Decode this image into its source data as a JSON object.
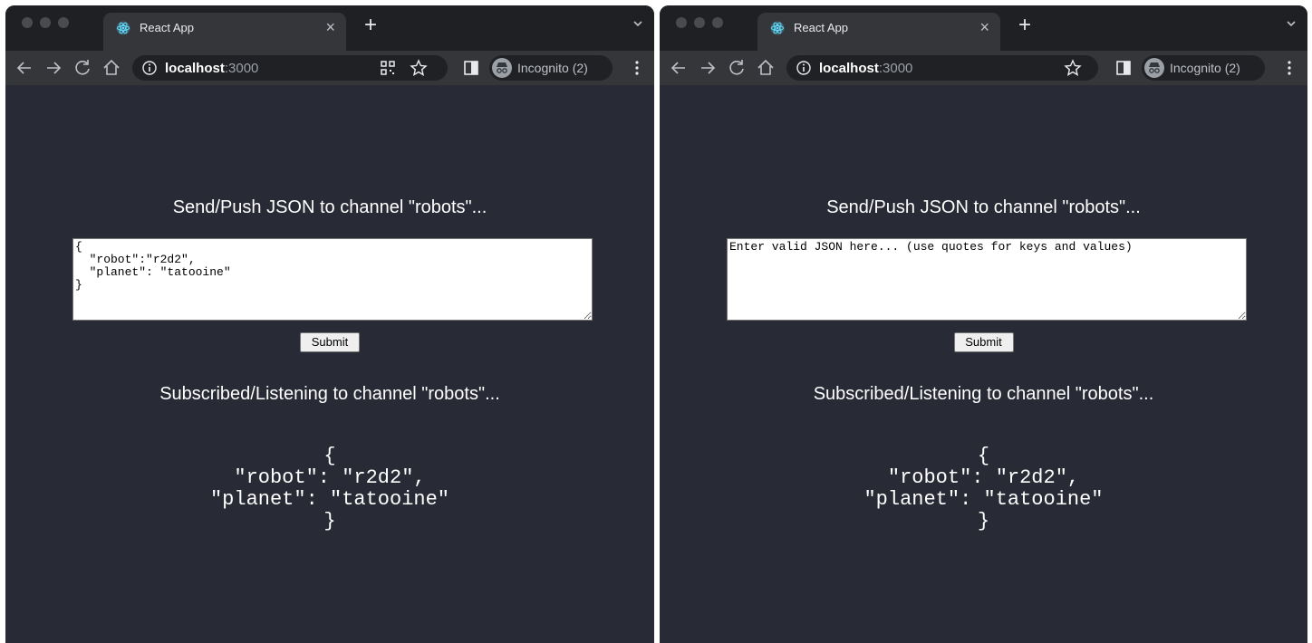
{
  "windows": [
    {
      "tab": {
        "title": "React App",
        "close": "×"
      },
      "new_tab": "+",
      "address": {
        "host": "localhost",
        "port": ":3000"
      },
      "incognito_label": "Incognito (2)",
      "content": {
        "send_heading": "Send/Push JSON to channel \"robots\"...",
        "input_value": "{\n  \"robot\":\"r2d2\",\n  \"planet\": \"tatooine\"\n}",
        "input_placeholder": "Enter valid JSON here... (use quotes for keys and values)",
        "submit_label": "Submit",
        "subscribe_heading": "Subscribed/Listening to channel \"robots\"...",
        "output_lines": [
          "{",
          "\"robot\": \"r2d2\",",
          "\"planet\": \"tatooine\"",
          "}"
        ]
      }
    },
    {
      "tab": {
        "title": "React App",
        "close": "×"
      },
      "new_tab": "+",
      "address": {
        "host": "localhost",
        "port": ":3000"
      },
      "incognito_label": "Incognito (2)",
      "content": {
        "send_heading": "Send/Push JSON to channel \"robots\"...",
        "input_value": "",
        "input_placeholder": "Enter valid JSON here... (use quotes for keys and values)",
        "submit_label": "Submit",
        "subscribe_heading": "Subscribed/Listening to channel \"robots\"...",
        "output_lines": [
          "{",
          "\"robot\": \"r2d2\",",
          "\"planet\": \"tatooine\"",
          "}"
        ]
      }
    }
  ],
  "colors": {
    "page_background": "#282a35",
    "titlebar": "#1f2023",
    "toolbar": "#35363a",
    "omnibox": "#202124",
    "text": "#ffffff"
  },
  "icons": [
    "react-logo-icon",
    "close-icon",
    "plus-icon",
    "chevron-down-icon",
    "back-arrow-icon",
    "forward-arrow-icon",
    "reload-icon",
    "home-icon",
    "info-icon",
    "qr-code-icon",
    "star-icon",
    "side-panel-icon",
    "incognito-icon",
    "more-vert-icon"
  ]
}
